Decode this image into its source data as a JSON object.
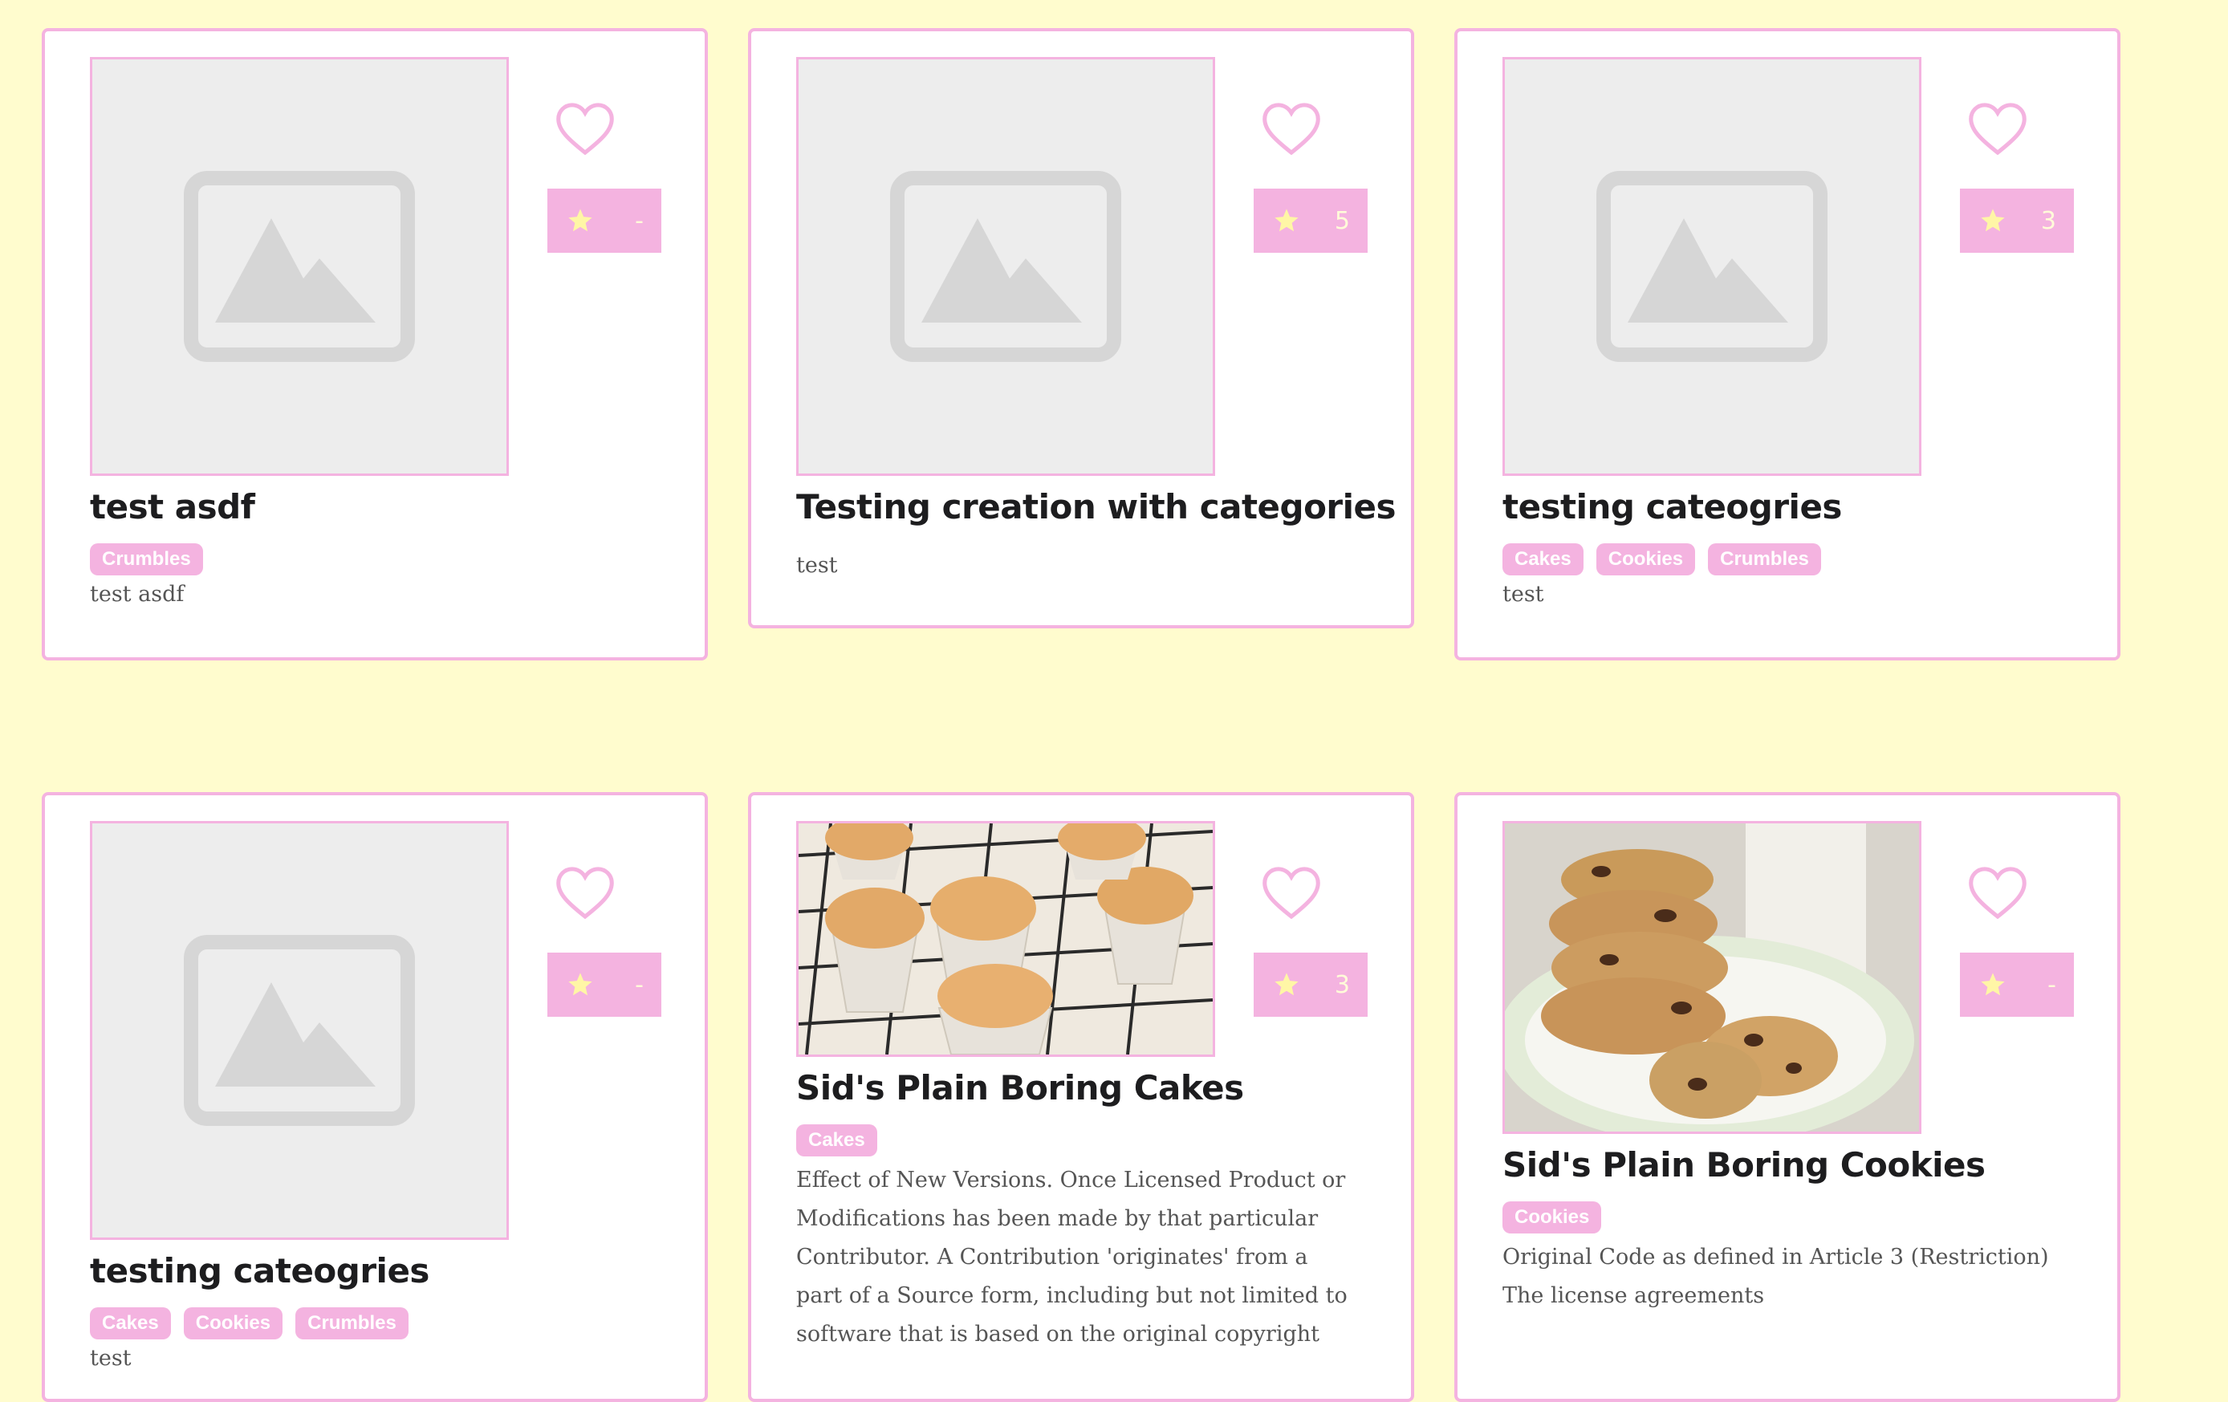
{
  "colors": {
    "background": "#fffcce",
    "accent": "#f4b3e0",
    "star": "#fff6a6"
  },
  "cards": [
    {
      "title": "test asdf",
      "rating": "-",
      "tags": [
        "Crumbles"
      ],
      "description": "test asdf",
      "image": "placeholder"
    },
    {
      "title": "Testing creation with categories",
      "rating": "5",
      "tags": [],
      "description": "test",
      "image": "placeholder"
    },
    {
      "title": "testing cateogries",
      "rating": "3",
      "tags": [
        "Cakes",
        "Cookies",
        "Crumbles"
      ],
      "description": "test",
      "image": "placeholder"
    },
    {
      "title": "testing cateogries",
      "rating": "-",
      "tags": [
        "Cakes",
        "Cookies",
        "Crumbles"
      ],
      "description": "test",
      "image": "placeholder"
    },
    {
      "title": "Sid's Plain Boring Cakes",
      "rating": "3",
      "tags": [
        "Cakes"
      ],
      "description": "Effect of New Versions. Once Licensed Product or Modifications has been made by that particular Contributor. A Contribution 'originates' from a part of a Source form, including but not limited to software that is based on the original copyright",
      "image": "cupcakes photo"
    },
    {
      "title": "Sid's Plain Boring Cookies",
      "rating": "-",
      "tags": [
        "Cookies"
      ],
      "description": "Original Code as defined in Article 3 (Restriction) The license agreements",
      "image": "cookies photo"
    }
  ]
}
